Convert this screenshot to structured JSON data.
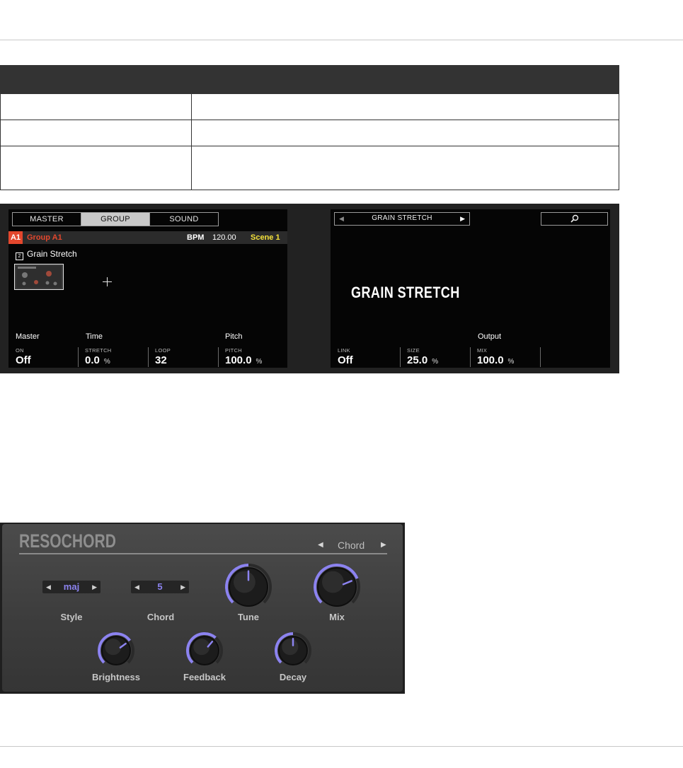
{
  "table": {
    "rows": [
      {
        "col1": "",
        "col2": ""
      },
      {
        "col1": "",
        "col2": ""
      },
      {
        "col1": "",
        "col2": ""
      }
    ]
  },
  "left_screen": {
    "tabs": [
      "MASTER",
      "GROUP",
      "SOUND"
    ],
    "active_tab": "GROUP",
    "group_id": "A1",
    "group_name": "Group A1",
    "bpm_label": "BPM",
    "bpm_value": "120.00",
    "scene": "Scene 1",
    "plugin_number": "2",
    "plugin_name": "Grain Stretch",
    "sections": {
      "master": "Master",
      "time": "Time",
      "pitch": "Pitch"
    },
    "params": [
      {
        "label": "ON",
        "value": "Off",
        "unit": ""
      },
      {
        "label": "STRETCH",
        "value": "0.0",
        "unit": "%"
      },
      {
        "label": "LOOP",
        "value": "32",
        "unit": ""
      },
      {
        "label": "PITCH",
        "value": "100.0",
        "unit": "%"
      }
    ]
  },
  "right_screen": {
    "nav_title": "GRAIN STRETCH",
    "big_title": "GRAIN STRETCH",
    "sections": {
      "output": "Output"
    },
    "params": [
      {
        "label": "LINK",
        "value": "Off",
        "unit": ""
      },
      {
        "label": "SIZE",
        "value": "25.0",
        "unit": "%"
      },
      {
        "label": "MIX",
        "value": "100.0",
        "unit": "%"
      }
    ]
  },
  "resochord": {
    "title": "RESOCHORD",
    "page": "Chord",
    "style": {
      "label": "Style",
      "value": "maj"
    },
    "chord": {
      "label": "Chord",
      "value": "5"
    },
    "knobs": [
      {
        "label": "Tune",
        "level": 0.5
      },
      {
        "label": "Mix",
        "level": 0.75
      },
      {
        "label": "Brightness",
        "level": 0.7
      },
      {
        "label": "Feedback",
        "level": 0.65
      },
      {
        "label": "Decay",
        "level": 0.5
      }
    ],
    "colors": {
      "accent": "#8c83f0"
    }
  }
}
